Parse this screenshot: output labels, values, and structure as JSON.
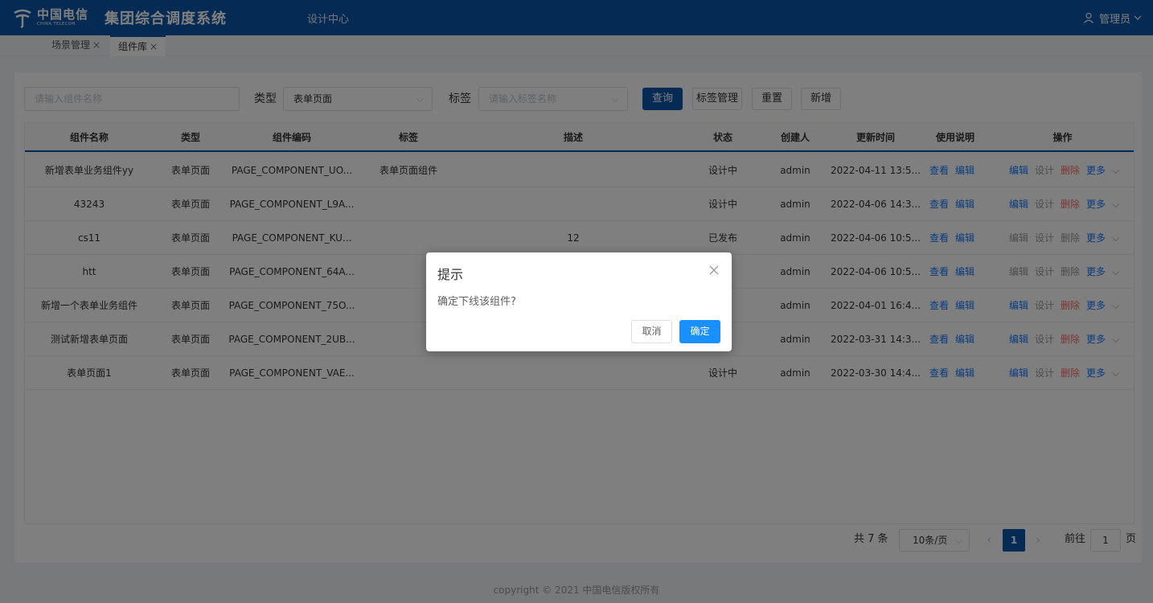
{
  "header": {
    "logo_cn": "中国电信",
    "logo_en": "CHINA TELECOM",
    "system_title": "集团综合调度系统",
    "nav_item": "设计中心",
    "user_name": "管理员"
  },
  "tabs": [
    {
      "label": "场景管理"
    },
    {
      "label": "组件库"
    }
  ],
  "search": {
    "name_placeholder": "请输入组件名称",
    "type_label": "类型",
    "type_value": "表单页面",
    "tag_label": "标签",
    "tag_placeholder": "请输入标签名称",
    "query_btn": "查询",
    "tag_manage_btn": "标签管理",
    "reset_btn": "重置",
    "add_btn": "新增"
  },
  "table": {
    "columns": [
      "组件名称",
      "类型",
      "组件编码",
      "标签",
      "描述",
      "状态",
      "创建人",
      "更新时间",
      "使用说明",
      "操作"
    ],
    "rows": [
      {
        "name": "新增表单业务组件yy",
        "type": "表单页面",
        "code": "PAGE_COMPONENT_UO...",
        "tag": "表单页面组件",
        "desc": "",
        "status": "设计中",
        "creator": "admin",
        "updated": "2022-04-11 13:5...",
        "del_red": true
      },
      {
        "name": "43243",
        "type": "表单页面",
        "code": "PAGE_COMPONENT_L9A...",
        "tag": "",
        "desc": "",
        "status": "设计中",
        "creator": "admin",
        "updated": "2022-04-06 14:3...",
        "del_red": true
      },
      {
        "name": "cs11",
        "type": "表单页面",
        "code": "PAGE_COMPONENT_KU...",
        "tag": "",
        "desc": "12",
        "status": "已发布",
        "creator": "admin",
        "updated": "2022-04-06 10:5...",
        "del_red": false
      },
      {
        "name": "htt",
        "type": "表单页面",
        "code": "PAGE_COMPONENT_64A...",
        "tag": "",
        "desc": "",
        "status": "布",
        "creator": "admin",
        "updated": "2022-04-06 10:5...",
        "del_red": false
      },
      {
        "name": "新增一个表单业务组件",
        "type": "表单页面",
        "code": "PAGE_COMPONENT_75O...",
        "tag": "",
        "desc": "",
        "status": "线",
        "creator": "admin",
        "updated": "2022-04-01 16:4...",
        "del_red": true
      },
      {
        "name": "测试新增表单页面",
        "type": "表单页面",
        "code": "PAGE_COMPONENT_2UB...",
        "tag": "",
        "desc": "",
        "status": "中",
        "creator": "admin",
        "updated": "2022-03-31 14:3...",
        "del_red": true
      },
      {
        "name": "表单页面1",
        "type": "表单页面",
        "code": "PAGE_COMPONENT_VAE...",
        "tag": "",
        "desc": "",
        "status": "设计中",
        "creator": "admin",
        "updated": "2022-03-30 14:4...",
        "del_red": true
      }
    ],
    "usage_links": [
      "查看",
      "编辑"
    ],
    "actions": [
      "编辑",
      "设计",
      "删除",
      "更多"
    ]
  },
  "pagination": {
    "total": "共 7 条",
    "page_size": "10条/页",
    "current_page": "1",
    "goto_label": "前往",
    "goto_value": "1",
    "goto_unit": "页"
  },
  "footer": "copyright © 2021 中国电信版权所有",
  "dialog": {
    "title": "提示",
    "message": "确定下线该组件?",
    "cancel": "取消",
    "confirm": "确定"
  }
}
